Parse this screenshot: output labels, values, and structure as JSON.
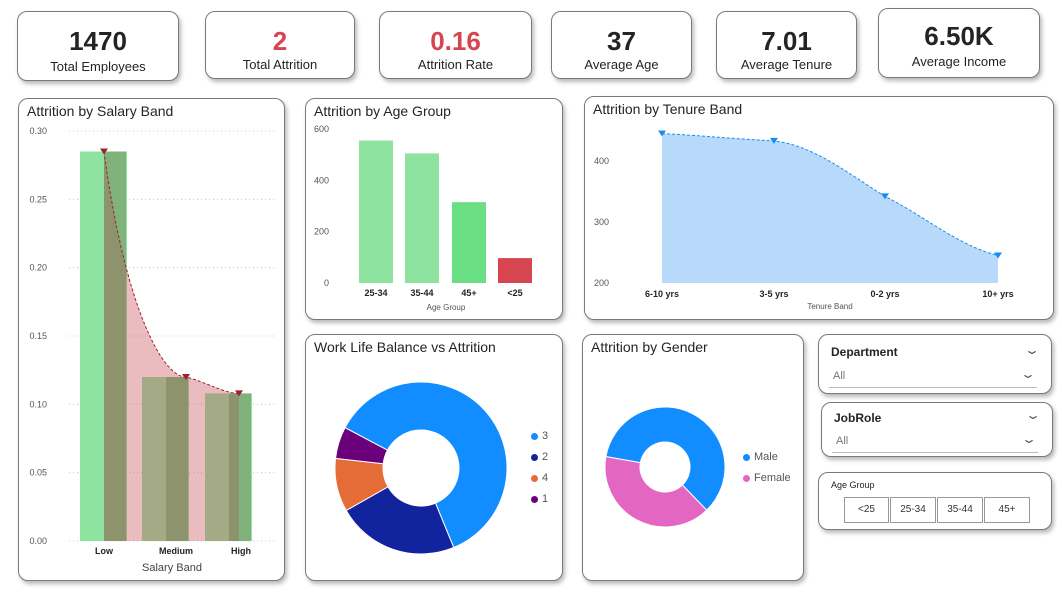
{
  "kpis": [
    {
      "value": "1470",
      "label": "Total Employees",
      "color": "#000000"
    },
    {
      "value": "2",
      "label": "Total Attrition",
      "color": "#d64550"
    },
    {
      "value": "0.16",
      "label": "Attrition Rate",
      "color": "#d64550"
    },
    {
      "value": "37",
      "label": "Average Age",
      "color": "#000000"
    },
    {
      "value": "7.01",
      "label": "Average Tenure",
      "color": "#000000"
    },
    {
      "value": "6.50K",
      "label": "Average Income",
      "color": "#000000"
    }
  ],
  "salary_chart": {
    "title": "Attrition by Salary Band",
    "xlabel": "Salary Band",
    "categories": [
      "Low",
      "Medium",
      "High"
    ],
    "yticks": [
      "0.30",
      "0.25",
      "0.20",
      "0.15",
      "0.10",
      "0.05",
      "0.00"
    ]
  },
  "age_chart": {
    "title": "Attrition by Age Group",
    "xlabel": "Age Group",
    "categories": [
      "25-34",
      "35-44",
      "45+",
      "<25"
    ],
    "yticks": [
      "600",
      "400",
      "200",
      "0"
    ]
  },
  "tenure_chart": {
    "title": "Attrition by Tenure Band",
    "xlabel": "Tenure Band",
    "categories": [
      "6-10 yrs",
      "3-5 yrs",
      "0-2 yrs",
      "10+ yrs"
    ],
    "yticks": [
      "400",
      "300",
      "200"
    ]
  },
  "wlb_chart": {
    "title": "Work Life Balance vs Attrition",
    "legend": [
      "3",
      "2",
      "4",
      "1"
    ]
  },
  "gender_chart": {
    "title": "Attrition by Gender",
    "legend": [
      "Male",
      "Female"
    ]
  },
  "slicers": {
    "department": {
      "title": "Department",
      "value": "All"
    },
    "jobrole": {
      "title": "JobRole",
      "value": "All"
    },
    "age_group": {
      "title": "Age Group",
      "options": [
        "<25",
        "25-34",
        "35-44",
        "45+"
      ]
    }
  },
  "colors": {
    "green": "#8fe3a0",
    "green_hi": "#6ade83",
    "red": "#d64550",
    "area_blue": "#b7dafb",
    "line_blue": "#1a8cf0",
    "wlb3": "#118dff",
    "wlb2": "#12239e",
    "wlb4": "#e66c37",
    "wlb1": "#6b007b",
    "male": "#118dff",
    "female": "#e466c3"
  },
  "chart_data": [
    {
      "type": "bar",
      "title": "Attrition by Salary Band",
      "xlabel": "Salary Band",
      "categories": [
        "Low",
        "Medium",
        "High"
      ],
      "series": [
        {
          "values": [
            0.285,
            0.12,
            0.108
          ]
        },
        {
          "values": [
            0.285,
            0.12,
            0.108
          ]
        }
      ],
      "ylim": [
        0,
        0.3
      ],
      "grid": true
    },
    {
      "type": "bar",
      "title": "Attrition by Age Group",
      "xlabel": "Age Group",
      "categories": [
        "25-34",
        "35-44",
        "45+",
        "<25"
      ],
      "values": [
        555,
        505,
        315,
        97
      ],
      "ylim": [
        0,
        600
      ]
    },
    {
      "type": "area",
      "title": "Attrition by Tenure Band",
      "xlabel": "Tenure Band",
      "categories": [
        "6-10 yrs",
        "3-5 yrs",
        "0-2 yrs",
        "10+ yrs"
      ],
      "values": [
        445,
        433,
        342,
        245
      ],
      "ylim": [
        200,
        470
      ]
    },
    {
      "type": "pie",
      "title": "Work Life Balance vs Attrition",
      "categories": [
        "3",
        "2",
        "4",
        "1"
      ],
      "values": [
        61,
        23,
        10,
        6
      ]
    },
    {
      "type": "pie",
      "title": "Attrition by Gender",
      "categories": [
        "Male",
        "Female"
      ],
      "values": [
        60,
        40
      ]
    }
  ]
}
